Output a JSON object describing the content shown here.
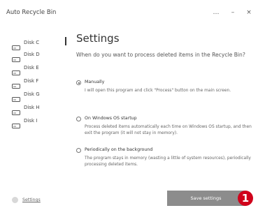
{
  "window": {
    "title": "Auto Recycle Bin",
    "more_icon": "ellipsis-icon",
    "more_glyph": "…",
    "minimize_glyph": "–",
    "close_glyph": "×"
  },
  "sidebar": {
    "items": [
      {
        "label": "Disk C",
        "icon": "drive-icon",
        "active": true
      },
      {
        "label": "Disk D",
        "icon": "drive-icon"
      },
      {
        "label": "Disk E",
        "icon": "drive-icon"
      },
      {
        "label": "Disk F",
        "icon": "drive-icon"
      },
      {
        "label": "Disk G",
        "icon": "drive-icon"
      },
      {
        "label": "Disk H",
        "icon": "drive-icon"
      },
      {
        "label": "Disk I",
        "icon": "drive-icon"
      }
    ]
  },
  "main": {
    "title": "Settings",
    "question": "When do you want to process deleted items in the Recycle Bin?",
    "options": [
      {
        "label": "Manually",
        "description": "I will open this program and click \"Process\" button on the main screen.",
        "selected": true
      },
      {
        "label": "On Windows OS startup",
        "description": "Process deleted items automatically each time on Windows OS startup, and then exit the program (it will not stay in memory).",
        "selected": false
      },
      {
        "label": "Periodically on the background",
        "description": "The program stays in memory (wasting a little of system resources), periodically processing deleted items.",
        "selected": false
      }
    ]
  },
  "footer": {
    "settings_link": "Settings",
    "save_button": "Save settings",
    "step_badge": "1"
  },
  "colors": {
    "save_button_bg": "#8c8c8c",
    "badge_bg": "#d0021b"
  }
}
